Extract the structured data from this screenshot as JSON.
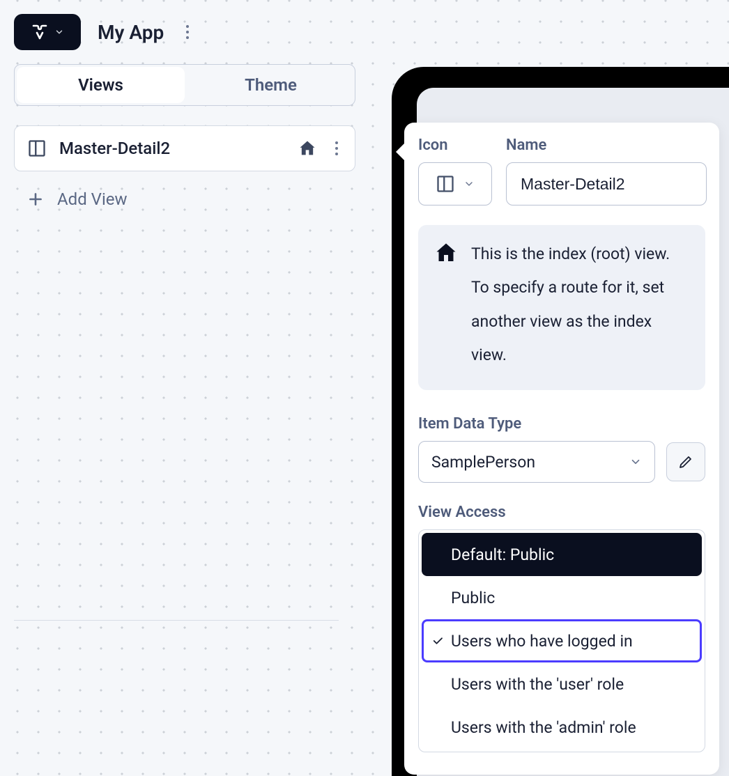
{
  "header": {
    "app_title": "My App"
  },
  "tabs": {
    "views": "Views",
    "theme": "Theme"
  },
  "views_list": {
    "item0_name": "Master-Detail2",
    "add_view": "Add View"
  },
  "popover": {
    "icon_label": "Icon",
    "name_label": "Name",
    "name_value": "Master-Detail2",
    "info_text": "This is the index (root) view. To specify a route for it, set another view as the index view.",
    "item_data_type_label": "Item Data Type",
    "item_data_type_value": "SamplePerson",
    "view_access_label": "View Access",
    "access_options": {
      "o0": "Default: Public",
      "o1": "Public",
      "o2": "Users who have logged in",
      "o3": "Users with the 'user' role",
      "o4": "Users with the 'admin' role"
    }
  }
}
